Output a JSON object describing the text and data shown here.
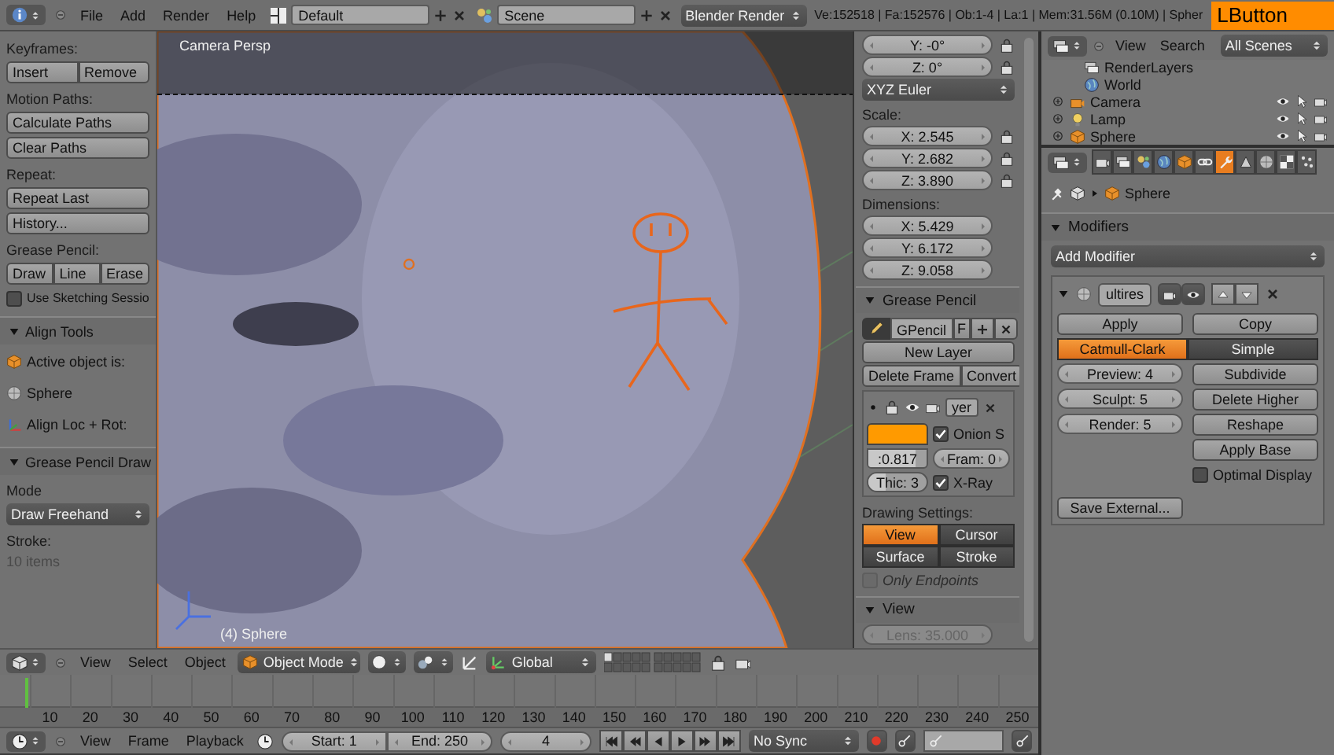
{
  "top_bar": {
    "menus": [
      "File",
      "Add",
      "Render",
      "Help"
    ],
    "layout": "Default",
    "scene": "Scene",
    "engine": "Blender Render",
    "stats": "Ve:152518 | Fa:152576 | Ob:1-4 | La:1 | Mem:31.56M (0.10M) | Spher",
    "key_overlay": "LButton"
  },
  "tool_shelf": [
    {
      "kind": "label",
      "text": "Keyframes:"
    },
    {
      "kind": "buttons",
      "items": [
        "Insert",
        "Remove"
      ]
    },
    {
      "kind": "label",
      "text": "Motion Paths:"
    },
    {
      "kind": "buttons",
      "items": [
        "Calculate Paths"
      ]
    },
    {
      "kind": "buttons",
      "items": [
        "Clear Paths"
      ]
    },
    {
      "kind": "label",
      "text": "Repeat:"
    },
    {
      "kind": "buttons",
      "items": [
        "Repeat Last"
      ]
    },
    {
      "kind": "buttons",
      "items": [
        "History..."
      ]
    },
    {
      "kind": "label",
      "text": "Grease Pencil:"
    },
    {
      "kind": "buttons",
      "items": [
        "Draw",
        "Line",
        "Erase"
      ]
    },
    {
      "kind": "checkbox",
      "text": "Use Sketching Sessio",
      "checked": false
    },
    {
      "kind": "panel",
      "text": "Align Tools",
      "expanded": true
    },
    {
      "kind": "object",
      "text": "Active object is:"
    },
    {
      "kind": "mesh",
      "text": "Sphere"
    },
    {
      "kind": "align",
      "text": "Align Loc + Rot:"
    },
    {
      "kind": "panel",
      "text": "Grease Pencil Draw",
      "expanded": true
    },
    {
      "kind": "label",
      "text": "Mode"
    },
    {
      "kind": "dropdown",
      "text": "Draw Freehand"
    },
    {
      "kind": "label",
      "text": "Stroke:"
    },
    {
      "kind": "muted",
      "text": "10 items"
    }
  ],
  "viewport": {
    "view_name": "Camera Persp",
    "object_info": "(4) Sphere"
  },
  "n_panel": [
    {
      "kind": "field",
      "text": "Y: -0°",
      "lock": true
    },
    {
      "kind": "field",
      "text": "Z: 0°",
      "lock": true
    },
    {
      "kind": "dropdown",
      "text": "XYZ Euler"
    },
    {
      "kind": "label",
      "text": "Scale:"
    },
    {
      "kind": "field",
      "text": "X: 2.545",
      "lock": true
    },
    {
      "kind": "field",
      "text": "Y: 2.682",
      "lock": true
    },
    {
      "kind": "field",
      "text": "Z: 3.890",
      "lock": true
    },
    {
      "kind": "label",
      "text": "Dimensions:"
    },
    {
      "kind": "field",
      "text": "X: 5.429",
      "lock": false
    },
    {
      "kind": "field",
      "text": "Y: 6.172",
      "lock": false
    },
    {
      "kind": "field",
      "text": "Z: 9.058",
      "lock": false
    },
    {
      "kind": "panel",
      "text": "Grease Pencil",
      "expanded": true
    },
    {
      "kind": "gpencil",
      "name": "GPencil",
      "flag": "F"
    },
    {
      "kind": "buttons",
      "items": [
        "New Layer"
      ]
    },
    {
      "kind": "buttons",
      "items": [
        "Delete Frame",
        "Convert"
      ]
    },
    {
      "kind": "layer",
      "name": "yer",
      "color": "#ff9a00",
      "opacity": {
        "text": ":0.817",
        "level": 0.817
      },
      "onion": {
        "text": "Onion S",
        "checked": true
      },
      "frames": "Fram: 0",
      "thickness": {
        "text": "Thic: 3",
        "level": 0.3
      },
      "xray": {
        "text": "X-Ray",
        "checked": true
      }
    },
    {
      "kind": "label",
      "text": "Drawing Settings:"
    },
    {
      "kind": "toggles",
      "items": [
        {
          "text": "View",
          "selected": true
        },
        {
          "text": "Cursor",
          "selected": false
        },
        {
          "text": "Surface",
          "selected": false
        },
        {
          "text": "Stroke",
          "selected": false
        }
      ]
    },
    {
      "kind": "checkbox",
      "text": "Only Endpoints",
      "checked": false,
      "disabled": true
    },
    {
      "kind": "panel",
      "text": "View",
      "expanded": true
    },
    {
      "kind": "field",
      "text": "Lens: 35.000",
      "lock": false,
      "disabled": true
    }
  ],
  "outliner": {
    "menus": [
      "View",
      "Search"
    ],
    "filter": "All Scenes",
    "items": [
      {
        "label": "RenderLayers",
        "kind": "layers"
      },
      {
        "label": "World",
        "kind": "world"
      },
      {
        "label": "Camera",
        "kind": "camera",
        "expanded": false
      },
      {
        "label": "Lamp",
        "kind": "lamp",
        "expanded": false
      },
      {
        "label": "Sphere",
        "kind": "object",
        "expanded": false
      }
    ]
  },
  "properties": {
    "tabs": [
      {
        "kind": "render",
        "selected": false
      },
      {
        "kind": "layers",
        "selected": false
      },
      {
        "kind": "scene",
        "selected": false
      },
      {
        "kind": "world",
        "selected": false
      },
      {
        "kind": "object",
        "selected": false
      },
      {
        "kind": "constraints",
        "selected": false
      },
      {
        "kind": "modifiers",
        "selected": true
      },
      {
        "kind": "data",
        "selected": false
      },
      {
        "kind": "material",
        "selected": false
      },
      {
        "kind": "texture",
        "selected": false
      },
      {
        "kind": "particles",
        "selected": false
      }
    ],
    "context": "Sphere",
    "panel": {
      "title": "Modifiers",
      "expanded": true,
      "add": "Add Modifier",
      "modifier": {
        "name": "ultires",
        "expanded": true,
        "apply": "Apply",
        "copy": "Copy",
        "types": [
          {
            "text": "Catmull-Clark",
            "selected": true
          },
          {
            "text": "Simple",
            "selected": false
          }
        ],
        "levels": [
          "Preview: 4",
          "Sculpt: 5",
          "Render: 5"
        ],
        "actions": [
          "Subdivide",
          "Delete Higher",
          "Reshape",
          "Apply Base"
        ],
        "optimal": {
          "text": "Optimal Display",
          "checked": false
        },
        "save": "Save External..."
      }
    }
  },
  "viewport_header": {
    "menus": [
      "View",
      "Select",
      "Object"
    ],
    "mode": "Object Mode",
    "orientation": "Global"
  },
  "timeline": {
    "ticks": [
      "10",
      "20",
      "30",
      "40",
      "50",
      "60",
      "70",
      "80",
      "90",
      "100",
      "110",
      "120",
      "130",
      "140",
      "150",
      "160",
      "170",
      "180",
      "190",
      "200",
      "210",
      "220",
      "230",
      "240",
      "250"
    ],
    "playhead": {
      "level": 0.016
    }
  },
  "timeline_header": {
    "menus": [
      "View",
      "Frame",
      "Playback"
    ],
    "start": "Start: 1",
    "end": "End: 250",
    "frame": "4",
    "sync": "No Sync"
  }
}
